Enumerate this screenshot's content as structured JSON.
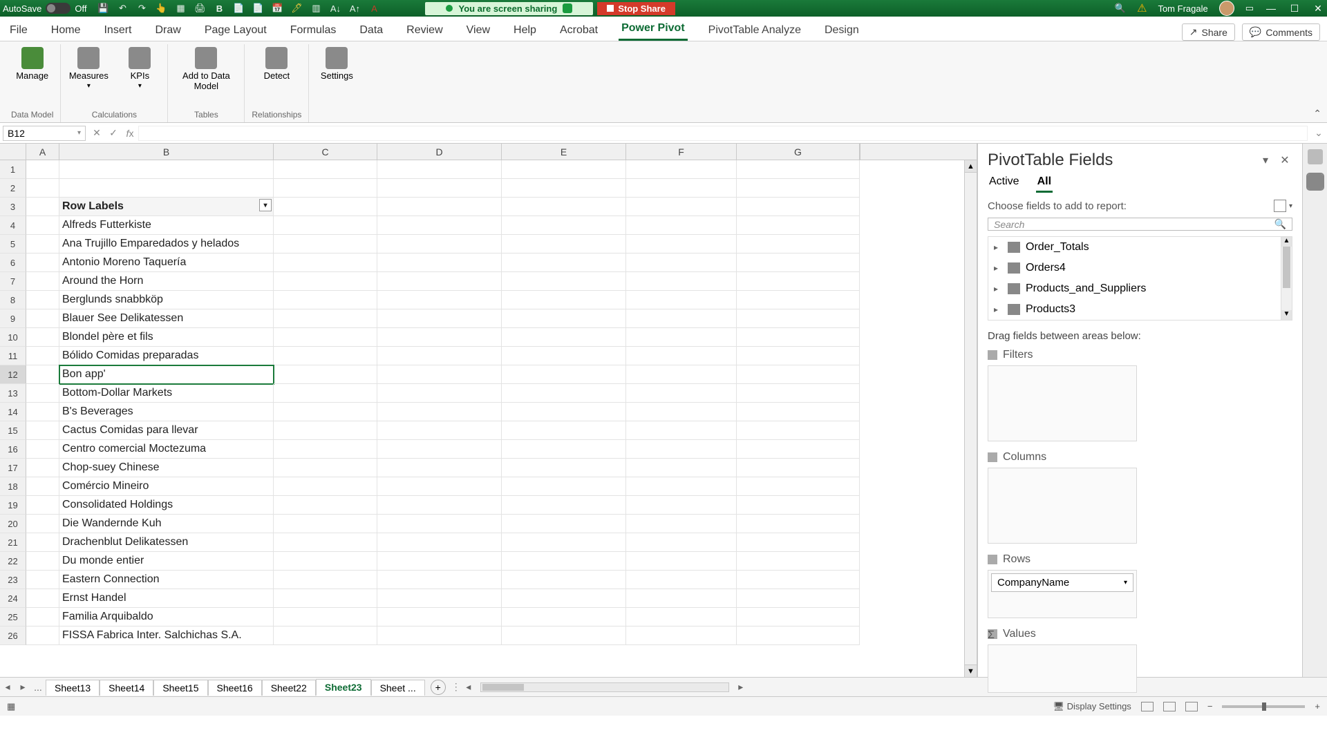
{
  "titlebar": {
    "autosave_label": "AutoSave",
    "autosave_state": "Off",
    "sharing_text": "You are screen sharing",
    "stop_share": "Stop Share",
    "user_name": "Tom Fragale"
  },
  "ribbon": {
    "tabs": [
      "File",
      "Home",
      "Insert",
      "Draw",
      "Page Layout",
      "Formulas",
      "Data",
      "Review",
      "View",
      "Help",
      "Acrobat"
    ],
    "active_tab": "Power Pivot",
    "context_tabs": [
      "PivotTable Analyze",
      "Design"
    ],
    "share": "Share",
    "comments": "Comments",
    "groups": {
      "data_model": {
        "label": "Data Model",
        "btns": [
          "Manage"
        ]
      },
      "calculations": {
        "label": "Calculations",
        "btns": [
          "Measures",
          "KPIs"
        ]
      },
      "tables": {
        "label": "Tables",
        "btns": [
          "Add to Data Model"
        ]
      },
      "relationships": {
        "label": "Relationships",
        "btns": [
          "Detect"
        ]
      },
      "settings": {
        "btns": [
          "Settings"
        ]
      }
    }
  },
  "formula_bar": {
    "name_box": "B12",
    "formula": ""
  },
  "grid": {
    "columns": [
      "A",
      "B",
      "C",
      "D",
      "E",
      "F",
      "G"
    ],
    "row_labels_header": "Row Labels",
    "selected_cell": "B12",
    "selected_row": 12,
    "rows": [
      {
        "n": 1,
        "b": ""
      },
      {
        "n": 2,
        "b": ""
      },
      {
        "n": 3,
        "b": "Row Labels",
        "hdr": true
      },
      {
        "n": 4,
        "b": "Alfreds Futterkiste"
      },
      {
        "n": 5,
        "b": "Ana Trujillo Emparedados y helados"
      },
      {
        "n": 6,
        "b": "Antonio Moreno Taquería"
      },
      {
        "n": 7,
        "b": "Around the Horn"
      },
      {
        "n": 8,
        "b": "Berglunds snabbköp"
      },
      {
        "n": 9,
        "b": "Blauer See Delikatessen"
      },
      {
        "n": 10,
        "b": "Blondel père et fils"
      },
      {
        "n": 11,
        "b": "Bólido Comidas preparadas"
      },
      {
        "n": 12,
        "b": "Bon app'",
        "sel": true
      },
      {
        "n": 13,
        "b": "Bottom-Dollar Markets"
      },
      {
        "n": 14,
        "b": "B's Beverages"
      },
      {
        "n": 15,
        "b": "Cactus Comidas para llevar"
      },
      {
        "n": 16,
        "b": "Centro comercial Moctezuma"
      },
      {
        "n": 17,
        "b": "Chop-suey Chinese"
      },
      {
        "n": 18,
        "b": "Comércio Mineiro"
      },
      {
        "n": 19,
        "b": "Consolidated Holdings"
      },
      {
        "n": 20,
        "b": "Die Wandernde Kuh"
      },
      {
        "n": 21,
        "b": "Drachenblut Delikatessen"
      },
      {
        "n": 22,
        "b": "Du monde entier"
      },
      {
        "n": 23,
        "b": "Eastern Connection"
      },
      {
        "n": 24,
        "b": "Ernst Handel"
      },
      {
        "n": 25,
        "b": "Familia Arquibaldo"
      },
      {
        "n": 26,
        "b": "FISSA Fabrica Inter. Salchichas S.A."
      }
    ]
  },
  "pane": {
    "title": "PivotTable Fields",
    "subtabs": {
      "active": "Active",
      "all": "All",
      "selected": "All"
    },
    "choose_text": "Choose fields to add to report:",
    "search_placeholder": "Search",
    "fields": [
      "Order_Totals",
      "Orders4",
      "Products_and_Suppliers",
      "Products3"
    ],
    "drag_text": "Drag fields between areas below:",
    "areas": {
      "filters": "Filters",
      "columns": "Columns",
      "rows": "Rows",
      "values": "Values"
    },
    "rows_field": "CompanyName"
  },
  "sheets": {
    "tabs": [
      "Sheet13",
      "Sheet14",
      "Sheet15",
      "Sheet16",
      "Sheet22",
      "Sheet23",
      "Sheet  ..."
    ],
    "active": "Sheet23",
    "ellipsis": "..."
  },
  "status": {
    "display_settings": "Display Settings"
  }
}
